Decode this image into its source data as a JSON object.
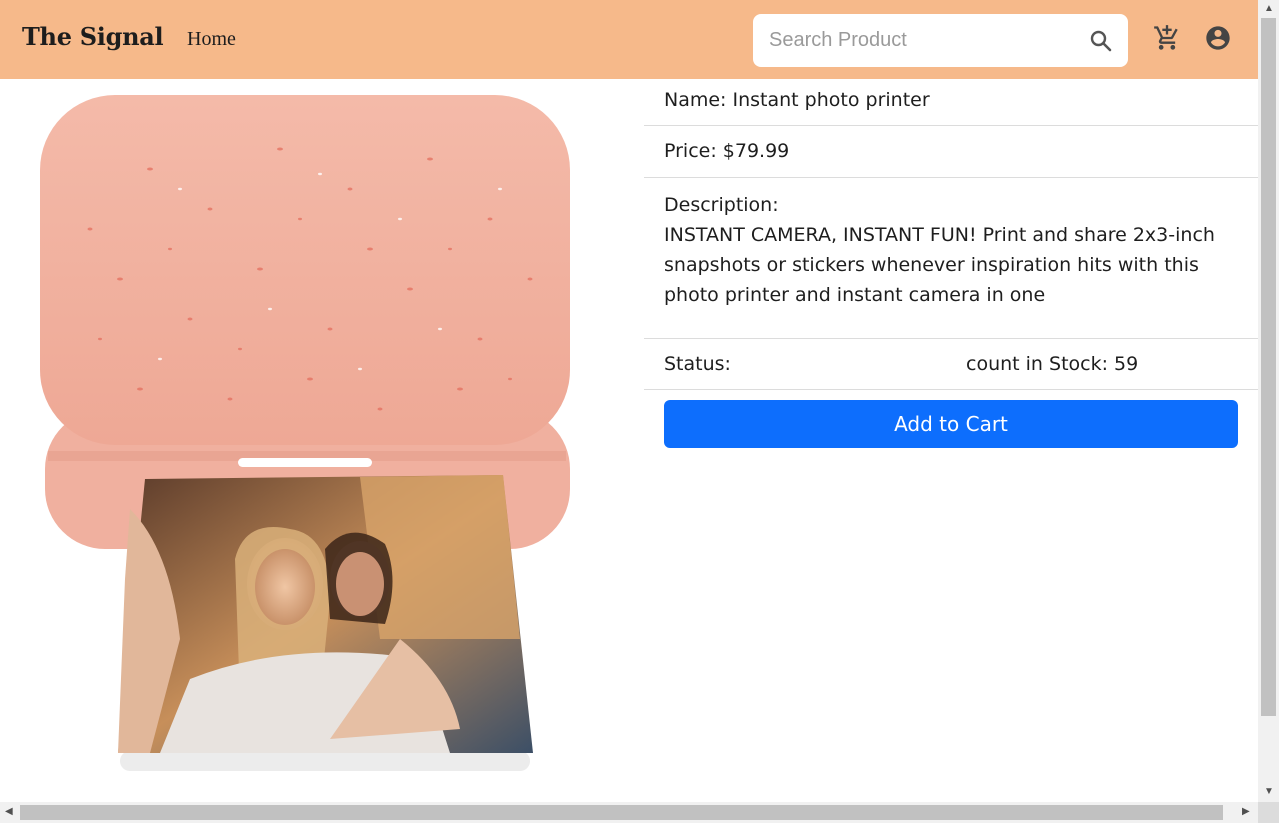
{
  "header": {
    "brand": "The Signal",
    "nav_home": "Home",
    "search_placeholder": "Search Product",
    "colors": {
      "background": "#f6b98a"
    }
  },
  "product": {
    "image_alt": "Instant photo printer",
    "name_line": "Name: Instant photo printer",
    "price_line": "Price: $79.99",
    "description_label": "Description:",
    "description_text": "INSTANT CAMERA, INSTANT FUN! Print and share 2x3-inch snapshots or stickers whenever inspiration hits with this photo printer and instant camera in one",
    "status_label": "Status:",
    "stock_text": "count in Stock: 59",
    "add_to_cart_label": "Add to Cart",
    "colors": {
      "printer": "#f3b5a3",
      "button": "#0d6efd"
    }
  },
  "icons": {
    "search": "search-icon",
    "cart": "add-to-cart-icon",
    "account": "account-circle-icon"
  }
}
